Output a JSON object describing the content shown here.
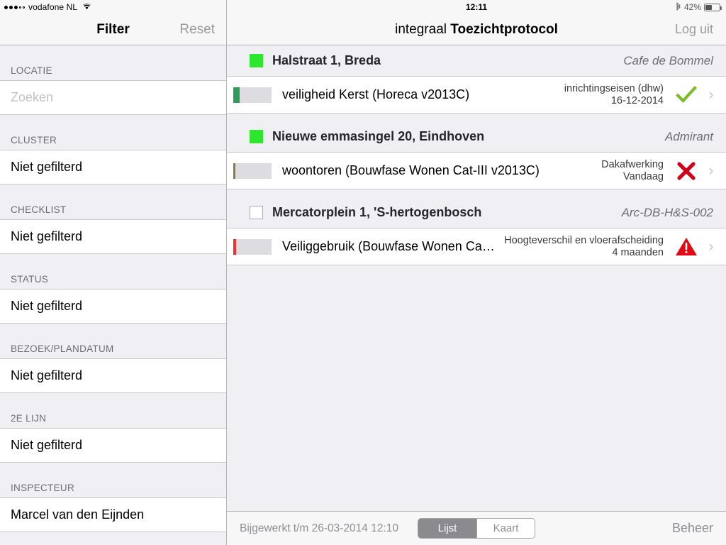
{
  "status_bar": {
    "carrier": "vodafone NL",
    "signal_filled": 3,
    "signal_hollow": 2,
    "wifi_icon": "wifi-icon",
    "time": "12:11",
    "bluetooth_icon": "bluetooth-icon",
    "battery_percent": "42%",
    "battery_level": 42
  },
  "sidebar": {
    "title": "Filter",
    "reset_label": "Reset",
    "sections": [
      {
        "header": "LOCATIE",
        "value": "Zoeken",
        "is_placeholder": true
      },
      {
        "header": "CLUSTER",
        "value": "Niet gefilterd",
        "is_placeholder": false
      },
      {
        "header": "CHECKLIST",
        "value": "Niet gefilterd",
        "is_placeholder": false
      },
      {
        "header": "STATUS",
        "value": "Niet gefilterd",
        "is_placeholder": false
      },
      {
        "header": "BEZOEK/PLANDATUM",
        "value": "Niet gefilterd",
        "is_placeholder": false
      },
      {
        "header": "2E LIJN",
        "value": "Niet gefilterd",
        "is_placeholder": false
      },
      {
        "header": "INSPECTEUR",
        "value": "Marcel van den Eijnden",
        "is_placeholder": false
      }
    ]
  },
  "main": {
    "title_light": "integraal ",
    "title_bold": "Toezichtprotocol",
    "logout_label": "Log uit",
    "groups": [
      {
        "marker": "filled-green-square",
        "address": "Halstraat 1, Breda",
        "owner": "Cafe de Bommel",
        "rows": [
          {
            "progress_color": "#2e9e58",
            "progress_pct": 16,
            "name": "veiligheid Kerst (Horeca v2013C)",
            "meta_line1": "inrichtingseisen (dhw)",
            "meta_line2": "16-12-2014",
            "status_icon": "check-icon",
            "status_color": "#7cbb2a",
            "chevron": "chevron-right-icon"
          }
        ]
      },
      {
        "marker": "filled-green-square",
        "address": "Nieuwe emmasingel 20, Eindhoven",
        "owner": "Admirant",
        "rows": [
          {
            "progress_color": "#8a7a4a",
            "progress_pct": 5,
            "name": "woontoren (Bouwfase Wonen Cat-III v2013C)",
            "meta_line1": "Dakafwerking",
            "meta_line2": "Vandaag",
            "status_icon": "cross-icon",
            "status_color": "#d0021b",
            "chevron": "chevron-right-icon"
          }
        ]
      },
      {
        "marker": "empty-checkbox",
        "address": "Mercatorplein 1, 'S-hertogenbosch",
        "owner": "Arc-DB-H&S-002",
        "rows": [
          {
            "progress_color": "#f23030",
            "progress_pct": 7,
            "name": "Veiliggebruik (Bouwfase Wonen Cat-I…",
            "meta_line1": "Hoogteverschil en vloerafscheiding",
            "meta_line2": "4 maanden",
            "status_icon": "warning-triangle-icon",
            "status_color": "#e30613",
            "chevron": "chevron-right-icon"
          }
        ]
      }
    ],
    "toolbar": {
      "updated_label": "Bijgewerkt t/m  26-03-2014 12:10",
      "segments": [
        {
          "label": "Lijst",
          "selected": true
        },
        {
          "label": "Kaart",
          "selected": false
        }
      ],
      "manage_label": "Beheer"
    }
  }
}
